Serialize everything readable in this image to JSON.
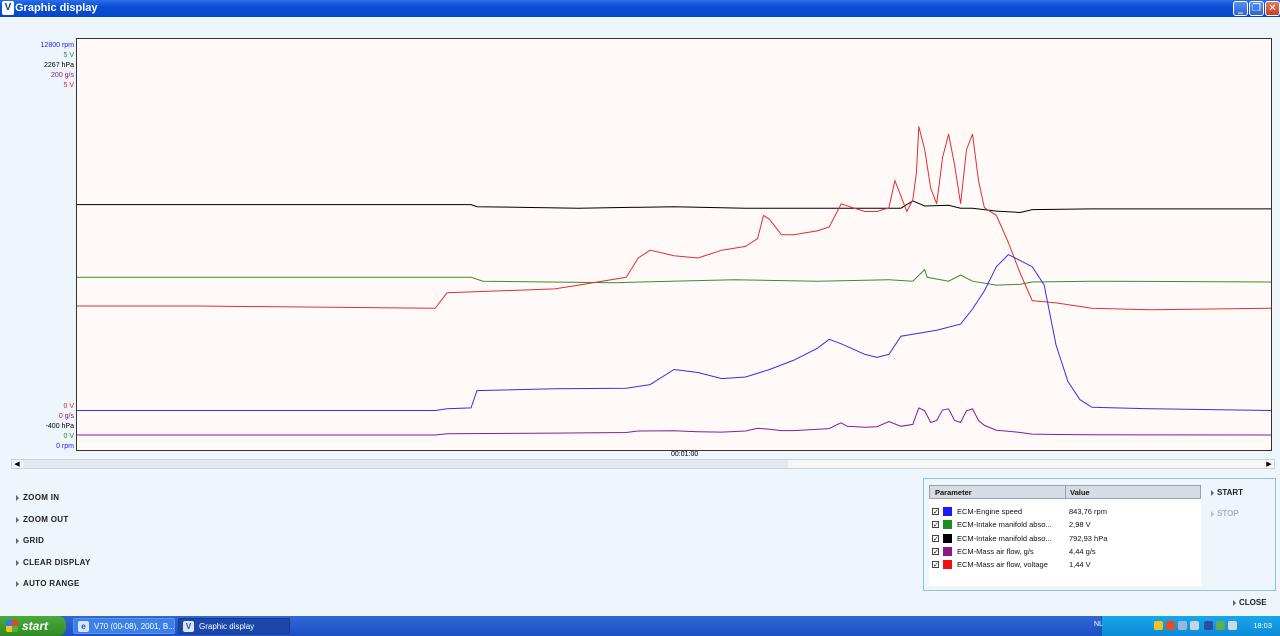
{
  "window": {
    "title": "Graphic display",
    "title_icon": "V",
    "buttons": {
      "minimize": "_",
      "maximize": "❐",
      "close": "✕"
    }
  },
  "graph": {
    "y_top_labels": [
      {
        "text": "12800 rpm",
        "color": "#1a1aff"
      },
      {
        "text": "5 V",
        "color": "#2a8a2a"
      },
      {
        "text": "2267 hPa",
        "color": "#000000"
      },
      {
        "text": "200 g/s",
        "color": "#8a1a8a"
      },
      {
        "text": "5 V",
        "color": "#e02020"
      }
    ],
    "y_bottom_labels": [
      {
        "text": "0 V",
        "color": "#e02020"
      },
      {
        "text": "0 g/s",
        "color": "#8a1a8a"
      },
      {
        "text": "-400 hPa",
        "color": "#000000"
      },
      {
        "text": "0 V",
        "color": "#2a8a2a"
      },
      {
        "text": "0 rpm",
        "color": "#1a1aff"
      }
    ],
    "time_label": "00:01:00"
  },
  "chart_data": {
    "type": "line",
    "series": [
      {
        "name": "ECM-Intake manifold abso... (V)",
        "color": "#3a8a3a",
        "points": [
          [
            0,
            2.05
          ],
          [
            0.33,
            2.05
          ],
          [
            0.34,
            2.0
          ],
          [
            0.45,
            1.98
          ],
          [
            0.55,
            2.02
          ],
          [
            0.62,
            2.0
          ],
          [
            0.68,
            2.02
          ],
          [
            0.7,
            2.0
          ],
          [
            0.71,
            2.15
          ],
          [
            0.712,
            2.05
          ],
          [
            0.73,
            2.0
          ],
          [
            0.74,
            2.08
          ],
          [
            0.75,
            2.0
          ],
          [
            0.77,
            1.95
          ],
          [
            0.79,
            1.96
          ],
          [
            0.8,
            1.99
          ],
          [
            0.85,
            2.0
          ],
          [
            1.0,
            1.99
          ]
        ]
      },
      {
        "name": "ECM-Intake manifold abso... (hPa)",
        "color": "#000000",
        "points": [
          [
            0,
            1195
          ],
          [
            0.33,
            1195
          ],
          [
            0.335,
            1180
          ],
          [
            0.42,
            1170
          ],
          [
            0.5,
            1180
          ],
          [
            0.56,
            1170
          ],
          [
            0.62,
            1170
          ],
          [
            0.69,
            1170
          ],
          [
            0.7,
            1220
          ],
          [
            0.71,
            1185
          ],
          [
            0.73,
            1190
          ],
          [
            0.74,
            1170
          ],
          [
            0.75,
            1170
          ],
          [
            0.77,
            1150
          ],
          [
            0.79,
            1140
          ],
          [
            0.8,
            1160
          ],
          [
            0.85,
            1165
          ],
          [
            1.0,
            1165
          ]
        ]
      },
      {
        "name": "ECM-Mass air flow, voltage",
        "color": "#e03030",
        "points": [
          [
            0,
            1.68
          ],
          [
            0.1,
            1.68
          ],
          [
            0.3,
            1.65
          ],
          [
            0.31,
            1.85
          ],
          [
            0.4,
            1.9
          ],
          [
            0.42,
            1.95
          ],
          [
            0.46,
            2.05
          ],
          [
            0.47,
            2.3
          ],
          [
            0.48,
            2.4
          ],
          [
            0.5,
            2.33
          ],
          [
            0.52,
            2.3
          ],
          [
            0.54,
            2.4
          ],
          [
            0.56,
            2.45
          ],
          [
            0.57,
            2.55
          ],
          [
            0.575,
            2.85
          ],
          [
            0.58,
            2.8
          ],
          [
            0.59,
            2.6
          ],
          [
            0.6,
            2.6
          ],
          [
            0.62,
            2.65
          ],
          [
            0.63,
            2.7
          ],
          [
            0.635,
            2.85
          ],
          [
            0.64,
            3.0
          ],
          [
            0.65,
            2.95
          ],
          [
            0.66,
            2.9
          ],
          [
            0.67,
            2.9
          ],
          [
            0.68,
            2.95
          ],
          [
            0.685,
            3.3
          ],
          [
            0.69,
            3.1
          ],
          [
            0.695,
            2.9
          ],
          [
            0.7,
            3.05
          ],
          [
            0.703,
            3.4
          ],
          [
            0.705,
            4.0
          ],
          [
            0.71,
            3.7
          ],
          [
            0.715,
            3.2
          ],
          [
            0.72,
            3.0
          ],
          [
            0.725,
            3.6
          ],
          [
            0.73,
            3.9
          ],
          [
            0.735,
            3.5
          ],
          [
            0.74,
            3.0
          ],
          [
            0.745,
            3.7
          ],
          [
            0.75,
            3.9
          ],
          [
            0.755,
            3.3
          ],
          [
            0.76,
            2.95
          ],
          [
            0.77,
            2.85
          ],
          [
            0.78,
            2.5
          ],
          [
            0.79,
            2.1
          ],
          [
            0.8,
            1.75
          ],
          [
            0.82,
            1.72
          ],
          [
            0.85,
            1.65
          ],
          [
            0.9,
            1.63
          ],
          [
            1.0,
            1.65
          ]
        ]
      },
      {
        "name": "ECM-Engine speed",
        "color": "#3333dd",
        "points": [
          [
            0,
            843
          ],
          [
            0.3,
            843
          ],
          [
            0.31,
            900
          ],
          [
            0.33,
            930
          ],
          [
            0.335,
            1500
          ],
          [
            0.4,
            1560
          ],
          [
            0.46,
            1580
          ],
          [
            0.48,
            1700
          ],
          [
            0.5,
            2200
          ],
          [
            0.52,
            2100
          ],
          [
            0.54,
            1900
          ],
          [
            0.56,
            1950
          ],
          [
            0.58,
            2200
          ],
          [
            0.6,
            2500
          ],
          [
            0.62,
            2900
          ],
          [
            0.63,
            3200
          ],
          [
            0.64,
            3050
          ],
          [
            0.66,
            2700
          ],
          [
            0.67,
            2600
          ],
          [
            0.68,
            2700
          ],
          [
            0.69,
            3300
          ],
          [
            0.72,
            3500
          ],
          [
            0.74,
            3700
          ],
          [
            0.75,
            4200
          ],
          [
            0.76,
            4800
          ],
          [
            0.77,
            5600
          ],
          [
            0.78,
            6000
          ],
          [
            0.79,
            5800
          ],
          [
            0.8,
            5600
          ],
          [
            0.81,
            5000
          ],
          [
            0.82,
            3000
          ],
          [
            0.83,
            1800
          ],
          [
            0.84,
            1200
          ],
          [
            0.85,
            950
          ],
          [
            0.9,
            900
          ],
          [
            1.0,
            843
          ]
        ]
      },
      {
        "name": "ECM-Mass air flow, g/s",
        "color": "#8a1a9a",
        "points": [
          [
            0,
            0.5
          ],
          [
            0.3,
            0.5
          ],
          [
            0.31,
            1.2
          ],
          [
            0.4,
            1.5
          ],
          [
            0.46,
            1.8
          ],
          [
            0.47,
            2.6
          ],
          [
            0.5,
            2.7
          ],
          [
            0.52,
            2.2
          ],
          [
            0.54,
            2.0
          ],
          [
            0.56,
            2.6
          ],
          [
            0.57,
            4.0
          ],
          [
            0.58,
            3.5
          ],
          [
            0.59,
            2.8
          ],
          [
            0.6,
            2.8
          ],
          [
            0.63,
            3.8
          ],
          [
            0.635,
            5.5
          ],
          [
            0.64,
            6.8
          ],
          [
            0.645,
            5.0
          ],
          [
            0.66,
            4.5
          ],
          [
            0.67,
            4.8
          ],
          [
            0.68,
            7.5
          ],
          [
            0.69,
            5.0
          ],
          [
            0.7,
            6.0
          ],
          [
            0.705,
            14.5
          ],
          [
            0.71,
            13.0
          ],
          [
            0.715,
            7.0
          ],
          [
            0.72,
            8.0
          ],
          [
            0.725,
            13.5
          ],
          [
            0.73,
            14.0
          ],
          [
            0.735,
            8.0
          ],
          [
            0.74,
            7.0
          ],
          [
            0.745,
            13.0
          ],
          [
            0.75,
            14.0
          ],
          [
            0.755,
            8.0
          ],
          [
            0.76,
            5.5
          ],
          [
            0.77,
            3.0
          ],
          [
            0.78,
            2.5
          ],
          [
            0.79,
            1.8
          ],
          [
            0.8,
            1.0
          ],
          [
            0.82,
            0.8
          ],
          [
            0.85,
            0.6
          ],
          [
            0.9,
            0.55
          ],
          [
            1.0,
            0.5
          ]
        ]
      }
    ],
    "ylims": {
      "rpm": [
        0,
        12800
      ],
      "v": [
        0,
        5
      ],
      "hpa": [
        -400,
        2267
      ],
      "gs": [
        0,
        200
      ]
    }
  },
  "commands": {
    "zoom_in": "ZOOM IN",
    "zoom_out": "ZOOM OUT",
    "grid": "GRID",
    "clear_display": "CLEAR DISPLAY",
    "auto_range": "AUTO RANGE",
    "start": "START",
    "stop": "STOP",
    "close": "CLOSE"
  },
  "params": {
    "header_param": "Parameter",
    "header_value": "Value",
    "rows": [
      {
        "name": "ECM-Engine speed",
        "value": "843,76 rpm",
        "color": "#1a1aff",
        "checked": true
      },
      {
        "name": "ECM-Intake manifold abso...",
        "value": "2,98 V",
        "color": "#1f8a1f",
        "checked": true
      },
      {
        "name": "ECM-Intake manifold abso...",
        "value": "792,93 hPa",
        "color": "#000000",
        "checked": true
      },
      {
        "name": "ECM-Mass air flow, g/s",
        "value": "4,44 g/s",
        "color": "#8a1a8a",
        "checked": true
      },
      {
        "name": "ECM-Mass air flow, voltage",
        "value": "1,44 V",
        "color": "#ee1111",
        "checked": true
      }
    ]
  },
  "taskbar": {
    "start_label": "start",
    "tasks": [
      {
        "label": "V70 (00-08), 2001, B...",
        "icon": "e"
      },
      {
        "label": "Graphic display",
        "icon": "V"
      }
    ],
    "lang": "NL",
    "clock": "18:03"
  }
}
